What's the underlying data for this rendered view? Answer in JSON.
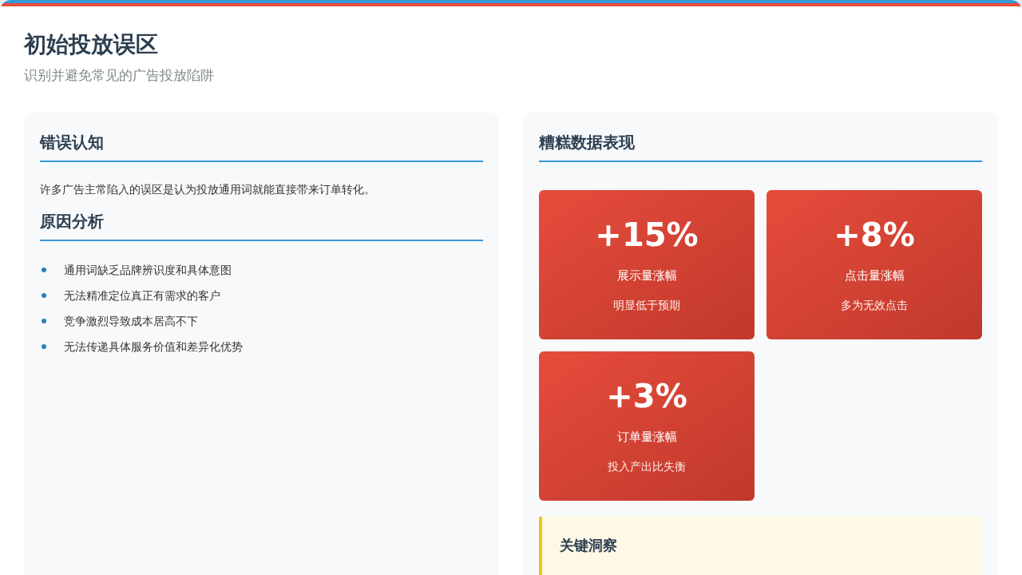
{
  "header": {
    "title": "初始投放误区",
    "subtitle": "识别并避免常见的广告投放陷阱"
  },
  "left": {
    "sections": [
      {
        "heading": "错误认知",
        "kind": "paragraph",
        "text": "许多广告主常陷入的误区是认为投放通用词就能直接带来订单转化。"
      },
      {
        "heading": "原因分析",
        "kind": "list",
        "items": [
          "通用词缺乏品牌辨识度和具体意图",
          "无法精准定位真正有需求的客户",
          "竞争激烈导致成本居高不下",
          "无法传递具体服务价值和差异化优势"
        ]
      }
    ]
  },
  "right": {
    "heading": "糟糕数据表现",
    "stats": [
      {
        "value": "+15%",
        "label": "展示量涨幅",
        "note": "明显低于预期"
      },
      {
        "value": "+8%",
        "label": "点击量涨幅",
        "note": "多为无效点击"
      },
      {
        "value": "+3%",
        "label": "订单量涨幅",
        "note": "投入产出比失衡"
      }
    ],
    "insight": {
      "heading": "关键洞察"
    }
  }
}
